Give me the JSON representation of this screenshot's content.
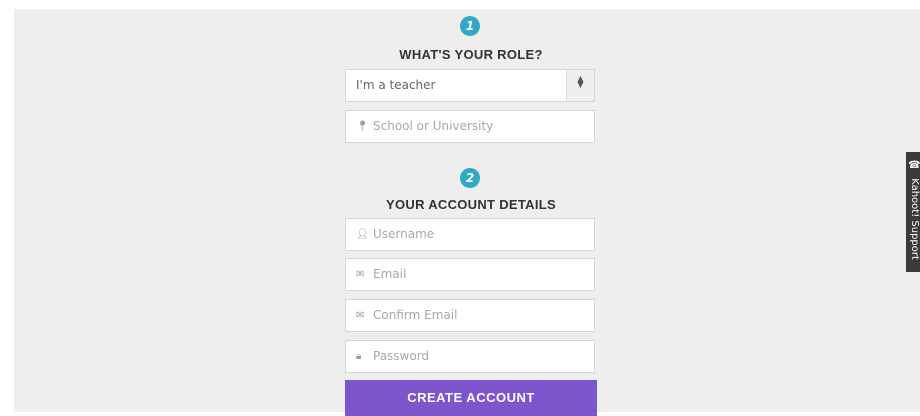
{
  "sections": {
    "role": {
      "step": "1",
      "title": "WHAT'S YOUR ROLE?"
    },
    "account": {
      "step": "2",
      "title": "YOUR ACCOUNT DETAILS"
    }
  },
  "role_select": {
    "selected": "I'm a teacher",
    "icon": "sort-arrows-icon"
  },
  "school_field": {
    "placeholder": "School or University",
    "icon": "map-pin-icon"
  },
  "username_field": {
    "placeholder": "Username",
    "icon": "user-icon"
  },
  "email_field": {
    "placeholder": "Email",
    "icon": "envelope-icon"
  },
  "confirm_email_field": {
    "placeholder": "Confirm Email",
    "icon": "envelope-icon"
  },
  "password_field": {
    "placeholder": "Password",
    "icon": "lock-icon"
  },
  "create_button": {
    "label": "CREATE ACCOUNT"
  },
  "support_tab": {
    "label": "Kahoot! Support",
    "icon": "headset-icon"
  },
  "colors": {
    "accent": "#7d55cc",
    "step_badge": "#2fa9c6",
    "background": "#eeeeee"
  }
}
